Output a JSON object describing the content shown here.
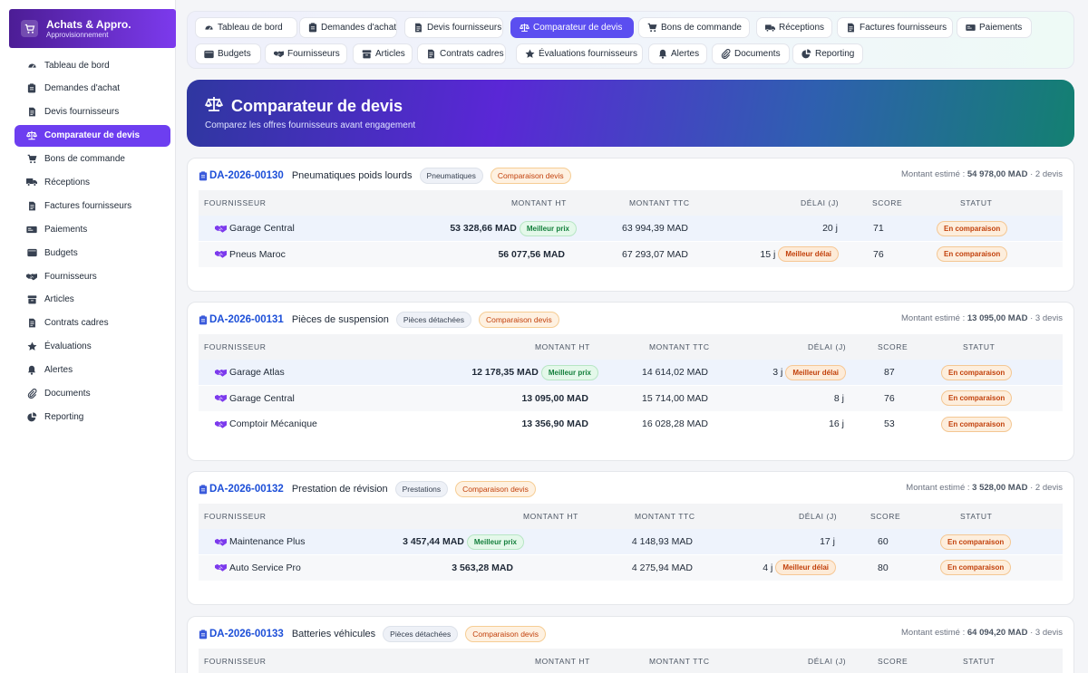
{
  "app": {
    "title": "Achats & Appro.",
    "subtitle": "Approvisionnement"
  },
  "sidebar": {
    "items": [
      {
        "label": "Tableau de bord",
        "icon": "dashboard-icon"
      },
      {
        "label": "Demandes d'achat",
        "icon": "clipboard-icon"
      },
      {
        "label": "Devis fournisseurs",
        "icon": "invoice-icon"
      },
      {
        "label": "Comparateur de devis",
        "icon": "scale-icon",
        "active": true
      },
      {
        "label": "Bons de commande",
        "icon": "cart-icon"
      },
      {
        "label": "Réceptions",
        "icon": "truck-icon"
      },
      {
        "label": "Factures fournisseurs",
        "icon": "invoice-icon"
      },
      {
        "label": "Paiements",
        "icon": "money-icon"
      },
      {
        "label": "Budgets",
        "icon": "wallet-icon"
      },
      {
        "label": "Fournisseurs",
        "icon": "handshake-icon"
      },
      {
        "label": "Articles",
        "icon": "box-icon"
      },
      {
        "label": "Contrats cadres",
        "icon": "contract-icon"
      },
      {
        "label": "Évaluations",
        "icon": "star-icon"
      },
      {
        "label": "Alertes",
        "icon": "bell-icon"
      },
      {
        "label": "Documents",
        "icon": "paperclip-icon"
      },
      {
        "label": "Reporting",
        "icon": "pie-icon"
      }
    ]
  },
  "topnav": {
    "tabs": [
      {
        "label": "Tableau de bord",
        "icon": "dashboard-icon"
      },
      {
        "label": "Demandes d'achat",
        "icon": "clipboard-icon"
      },
      {
        "label": "Devis fournisseurs",
        "icon": "invoice-icon"
      },
      {
        "label": "Comparateur de devis",
        "icon": "scale-icon",
        "active": true
      },
      {
        "label": "Bons de commande",
        "icon": "cart-icon"
      },
      {
        "label": "Réceptions",
        "icon": "truck-icon"
      },
      {
        "label": "Factures fournisseurs",
        "icon": "invoice-icon"
      },
      {
        "label": "Paiements",
        "icon": "money-icon"
      },
      {
        "label": "Budgets",
        "icon": "wallet-icon"
      },
      {
        "label": "Fournisseurs",
        "icon": "handshake-icon"
      },
      {
        "label": "Articles",
        "icon": "box-icon"
      },
      {
        "label": "Contrats cadres",
        "icon": "contract-icon"
      },
      {
        "label": "Évaluations fournisseurs",
        "icon": "star-icon"
      },
      {
        "label": "Alertes",
        "icon": "bell-icon"
      },
      {
        "label": "Documents",
        "icon": "paperclip-icon"
      },
      {
        "label": "Reporting",
        "icon": "pie-icon"
      }
    ]
  },
  "hero": {
    "title": "Comparateur de devis",
    "subtitle": "Comparez les offres fournisseurs avant engagement"
  },
  "table_headers": {
    "supplier": "FOURNISSEUR",
    "ht": "MONTANT HT",
    "ttc": "MONTANT TTC",
    "delay": "DÉLAI (J)",
    "score": "SCORE",
    "status": "STATUT"
  },
  "labels": {
    "estimated": "Montant estimé :",
    "best_price": "Meilleur prix",
    "best_delay": "Meilleur délai",
    "comparing": "En comparaison"
  },
  "colors": {
    "accent": "#6d3ef0",
    "link": "#1d4fd8",
    "best_price": "#15803d",
    "warning": "#c2410c"
  },
  "requests": [
    {
      "id": "DA-2026-00130",
      "title": "Pneumatiques poids lourds",
      "category": "Pneumatiques",
      "status": "Comparaison devis",
      "amount": "54 978,00 MAD",
      "count": "2 devis",
      "quotes": [
        {
          "supplier": "Garage Central",
          "ht": "53 328,66 MAD",
          "ttc": "63 994,39 MAD",
          "delay": "20 j",
          "score": "71",
          "best_price": true,
          "best_delay": false
        },
        {
          "supplier": "Pneus Maroc",
          "ht": "56 077,56 MAD",
          "ttc": "67 293,07 MAD",
          "delay": "15 j",
          "score": "76",
          "best_price": false,
          "best_delay": true
        }
      ]
    },
    {
      "id": "DA-2026-00131",
      "title": "Pièces de suspension",
      "category": "Pièces détachées",
      "status": "Comparaison devis",
      "amount": "13 095,00 MAD",
      "count": "3 devis",
      "quotes": [
        {
          "supplier": "Garage Atlas",
          "ht": "12 178,35 MAD",
          "ttc": "14 614,02 MAD",
          "delay": "3 j",
          "score": "87",
          "best_price": true,
          "best_delay": true
        },
        {
          "supplier": "Garage Central",
          "ht": "13 095,00 MAD",
          "ttc": "15 714,00 MAD",
          "delay": "8 j",
          "score": "76",
          "best_price": false,
          "best_delay": false
        },
        {
          "supplier": "Comptoir Mécanique",
          "ht": "13 356,90 MAD",
          "ttc": "16 028,28 MAD",
          "delay": "16 j",
          "score": "53",
          "best_price": false,
          "best_delay": false
        }
      ]
    },
    {
      "id": "DA-2026-00132",
      "title": "Prestation de révision",
      "category": "Prestations",
      "status": "Comparaison devis",
      "amount": "3 528,00 MAD",
      "count": "2 devis",
      "quotes": [
        {
          "supplier": "Maintenance Plus",
          "ht": "3 457,44 MAD",
          "ttc": "4 148,93 MAD",
          "delay": "17 j",
          "score": "60",
          "best_price": true,
          "best_delay": false
        },
        {
          "supplier": "Auto Service Pro",
          "ht": "3 563,28 MAD",
          "ttc": "4 275,94 MAD",
          "delay": "4 j",
          "score": "80",
          "best_price": false,
          "best_delay": true
        }
      ]
    },
    {
      "id": "DA-2026-00133",
      "title": "Batteries véhicules",
      "category": "Pièces détachées",
      "status": "Comparaison devis",
      "amount": "64 094,20 MAD",
      "count": "3 devis",
      "quotes": []
    }
  ]
}
